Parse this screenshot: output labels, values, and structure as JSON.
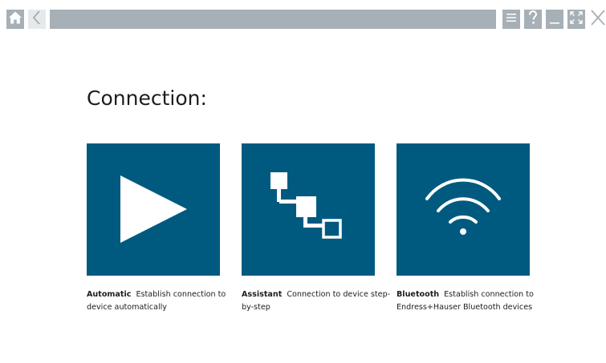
{
  "toolbar": {
    "icons": [
      "home-icon",
      "back-icon",
      "menu-icon",
      "help-icon",
      "minimize-icon",
      "maximize-icon",
      "close-icon"
    ],
    "colors": {
      "bar": "#a6b0b6",
      "icon": "#ffffff",
      "back_bg": "#e6e9eb",
      "close_stroke": "#a6b0b6"
    }
  },
  "page": {
    "title": "Connection:"
  },
  "options": [
    {
      "name": "Automatic",
      "description": "Establish connection to device automatically",
      "icon": "play-icon"
    },
    {
      "name": "Assistant",
      "description": "Connection to device step-by-step",
      "icon": "step-diagram-icon"
    },
    {
      "name": "Bluetooth",
      "description": "Establish connection to Endress+Hauser Bluetooth devices",
      "icon": "wifi-icon"
    }
  ],
  "colors": {
    "tile": "#005a80",
    "tile_icon": "#ffffff",
    "text": "#1d1d1b"
  }
}
